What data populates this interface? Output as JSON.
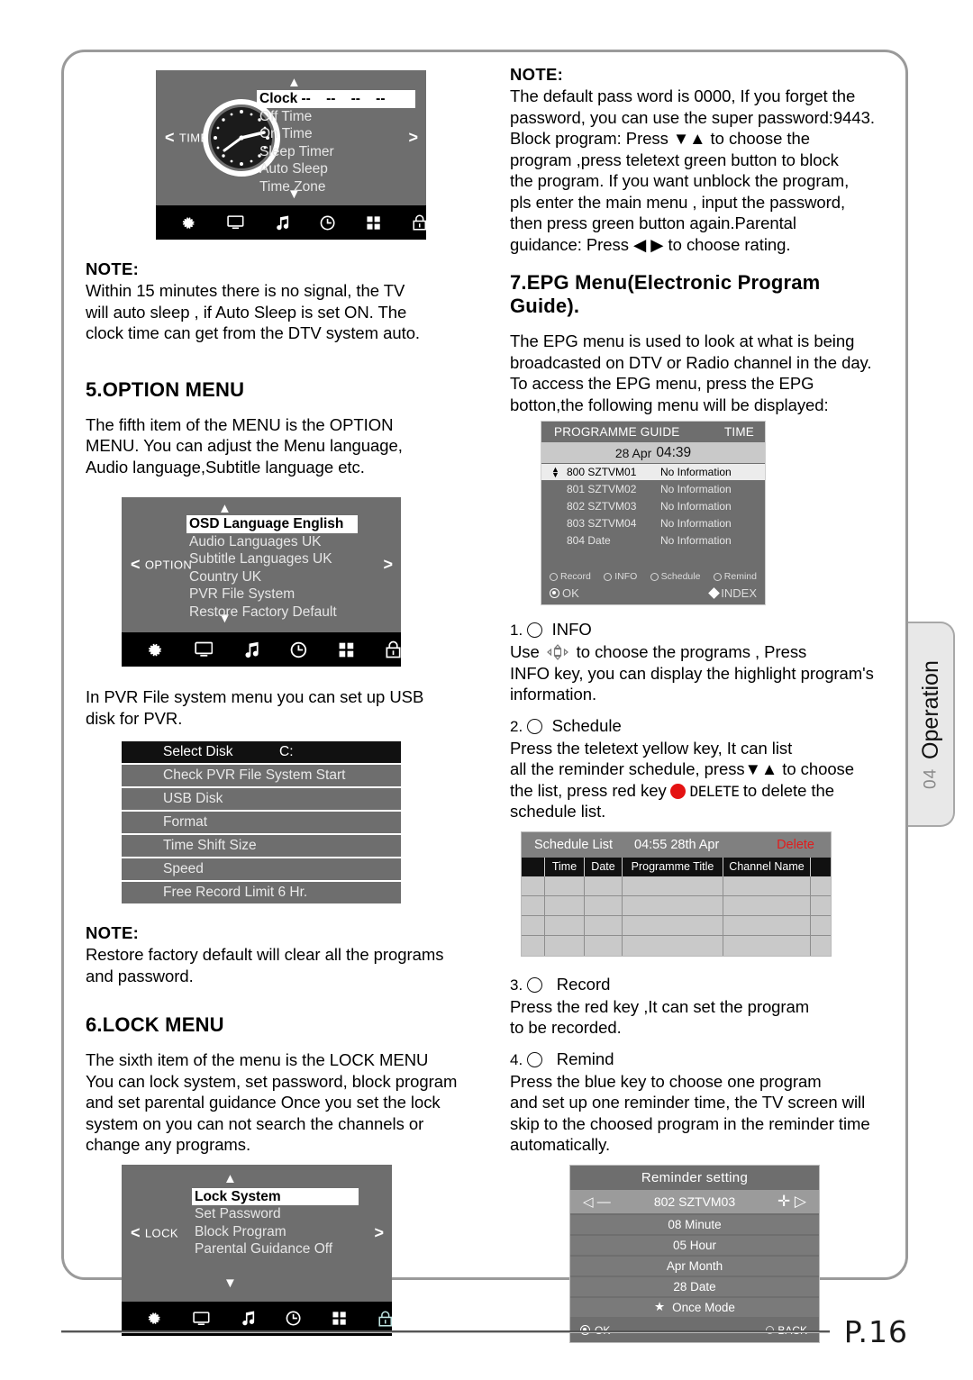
{
  "page": {
    "number": "P.16"
  },
  "side_tab": {
    "number": "04",
    "label": "Operation"
  },
  "left": {
    "time_osd": {
      "left_label": "TIME",
      "left_chevron": "<",
      "right_chevron": ">",
      "arrow_up": "▲",
      "arrow_down": "▼",
      "items": [
        {
          "label": "Clock --    --    --    --",
          "selected": true
        },
        {
          "label": "Off Time",
          "selected": false
        },
        {
          "label": "On Time",
          "selected": false
        },
        {
          "label": "Sleep Timer",
          "selected": false
        },
        {
          "label": "Auto Sleep",
          "selected": false
        },
        {
          "label": "Time Zone",
          "selected": false
        }
      ],
      "icons": [
        "gear-icon",
        "picture-icon",
        "sound-icon",
        "time-icon",
        "option-icon",
        "lock-icon"
      ]
    },
    "note1": {
      "head": "NOTE:",
      "body": "Within 15 minutes there is no signal,  the TV\nwill auto sleep , if Auto Sleep is set ON. The\nclock time can get from the DTV system auto."
    },
    "section5": {
      "heading": "5.OPTION MENU",
      "body": "The fifth item of the MENU is the OPTION\nMENU. You can adjust the Menu language,\nAudio language,Subtitle language etc."
    },
    "option_osd": {
      "left_label": "OPTION",
      "left_chevron": "<",
      "right_chevron": ">",
      "arrow_up": "▲",
      "arrow_down": "▼",
      "items": [
        {
          "label": "OSD Language English",
          "selected": true
        },
        {
          "label": "Audio Languages UK",
          "selected": false
        },
        {
          "label": "Subtitle Languages UK",
          "selected": false
        },
        {
          "label": "Country UK",
          "selected": false
        },
        {
          "label": "PVR File System",
          "selected": false
        },
        {
          "label": "Restore Factory Default",
          "selected": false
        }
      ],
      "icons": [
        "gear-icon",
        "picture-icon",
        "sound-icon",
        "time-icon",
        "option-icon",
        "lock-icon"
      ]
    },
    "pvr_intro": "In PVR File system menu you can set up USB\ndisk for PVR.",
    "pvr_table": {
      "rows": [
        {
          "label": "Select Disk",
          "value": "C:",
          "highlighted": true
        },
        {
          "label": "Check PVR File System Start",
          "value": "",
          "highlighted": false
        },
        {
          "label": "USB Disk",
          "value": "",
          "highlighted": false
        },
        {
          "label": "Format",
          "value": "",
          "highlighted": false
        },
        {
          "label": "Time Shift Size",
          "value": "",
          "highlighted": false
        },
        {
          "label": "Speed",
          "value": "",
          "highlighted": false
        },
        {
          "label": "Free Record Limit 6 Hr.",
          "value": "",
          "highlighted": false
        }
      ]
    },
    "note2": {
      "head": "NOTE:",
      "body": "Restore factory default will clear all the programs\nand password."
    },
    "section6": {
      "heading": "6.LOCK MENU",
      "body": "The sixth item of the menu is the LOCK MENU\nYou can lock system, set password, block program\nand set parental  guidance Once you set the lock\nsystem on you can not search the channels or\nchange  any programs."
    },
    "lock_osd": {
      "left_label": "LOCK",
      "left_chevron": "<",
      "right_chevron": ">",
      "arrow_up": "▲",
      "arrow_down": "▼",
      "items": [
        {
          "label": "Lock System",
          "selected": true
        },
        {
          "label": "Set Password",
          "selected": false
        },
        {
          "label": "Block Program",
          "selected": false
        },
        {
          "label": "Parental Guidance Off",
          "selected": false
        }
      ],
      "icons": [
        "gear-icon",
        "picture-icon",
        "sound-icon",
        "time-icon",
        "option-icon",
        "lock-icon"
      ]
    }
  },
  "right": {
    "note3": {
      "head": "NOTE:",
      "body": "The default pass word is 0000, If you forget the\npassword, you can use the super password:9443.\nBlock program: Press ▼▲ to choose the\nprogram ,press teletext green button to block\nthe program.  If you want unblock the program,\npls enter the main menu , input the password,\nthen press green button again.Parental\nguidance: Press ◀ ▶ to choose rating."
    },
    "section7": {
      "heading": "7.EPG Menu(Electronic Program\n  Guide).",
      "body": "The EPG menu is used to look at what is being\nbroadcasted on DTV or Radio channel  in the day.\nTo access the EPG menu, press the EPG\nbotton,the following menu will be displayed:"
    },
    "epg": {
      "title": "PROGRAMME GUIDE",
      "time_label": "TIME",
      "date": "28 Apr",
      "clock": "04:39",
      "rows": [
        {
          "channel": "800 SZTVM01",
          "info": "No Information",
          "selected": true
        },
        {
          "channel": "801 SZTVM02",
          "info": "No Information",
          "selected": false
        },
        {
          "channel": "802 SZTVM03",
          "info": "No Information",
          "selected": false
        },
        {
          "channel": "803 SZTVM04",
          "info": "No Information",
          "selected": false
        },
        {
          "channel": "804 Date",
          "info": "No Information",
          "selected": false
        }
      ],
      "buttons": [
        "Record",
        "INFO",
        "Schedule",
        "Remind"
      ],
      "ok_label": "OK",
      "index_label": "INDEX"
    },
    "steps": {
      "s1_num": "1.",
      "s1_title": "INFO",
      "s1_body_a": "Use",
      "s1_body_b": "to choose the programs , Press\nINFO key, you  can display the highlight  program's\ninformation.",
      "s2_num": "2.",
      "s2_title": "Schedule",
      "s2_body_a": "Press  the  teletext yellow key, It can list\nall the reminder schedule, press▼▲  to choose\nthe list,  press red key",
      "s2_delete": "DELETE",
      "s2_body_b": "to delete the\nschedule list.",
      "s3_num": "3.",
      "s3_title": "Record",
      "s3_body": "Press  the  red key ,It can set the program\nto be recorded.",
      "s4_num": "4.",
      "s4_title": "Remind",
      "s4_body": "Press the blue key to choose one program\nand set up one reminder time, the TV screen will\nskip to the choosed program in the reminder time\nautomatically."
    },
    "schedule_list": {
      "title": "Schedule List",
      "time": "04:55  28th Apr",
      "delete": "Delete",
      "columns": [
        "",
        "Time",
        "Date",
        "Programme Title",
        "Channel Name",
        ""
      ],
      "rows": 4
    },
    "reminder": {
      "title": "Reminder setting",
      "left_minus": "◁ —",
      "channel": "802 SZTVM03",
      "right_plus": "✛ ▷",
      "rows": [
        {
          "label": "08 Minute",
          "star": false
        },
        {
          "label": "05 Hour",
          "star": false
        },
        {
          "label": "Apr Month",
          "star": false
        },
        {
          "label": "28 Date",
          "star": false
        },
        {
          "label": "Once Mode",
          "star": true
        }
      ],
      "ok_label": "OK",
      "back_label": "BACK"
    }
  }
}
